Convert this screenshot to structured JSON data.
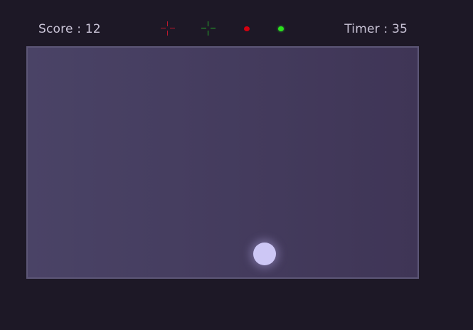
{
  "hud": {
    "score_text": "Score : 12",
    "timer_text": "Timer : 35",
    "indicators": [
      {
        "name": "crosshair-red-icon",
        "color": "#c0182c"
      },
      {
        "name": "crosshair-green-icon",
        "color": "#27b52a"
      },
      {
        "name": "dot-red-icon",
        "color": "#d4000f"
      },
      {
        "name": "dot-green-icon",
        "color": "#2be11d"
      }
    ]
  },
  "arena": {
    "ball": {
      "color": "#cdc7f5"
    }
  },
  "colors": {
    "background": "#1d1826",
    "arena_fill": "#463e5f",
    "arena_border": "#5c5676",
    "text": "#c9c3d6"
  }
}
